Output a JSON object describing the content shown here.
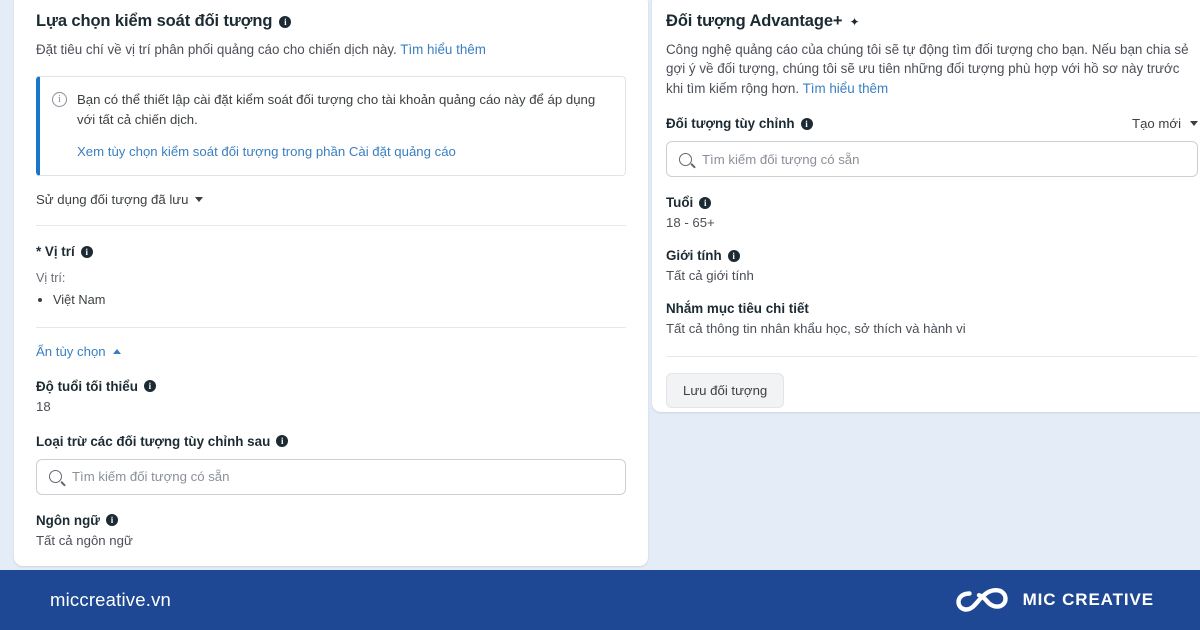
{
  "theme": {
    "page_background": "#e4ecf7",
    "card_background": "#ffffff",
    "link_color": "#3a7fc1",
    "banner_accent": "#1877c8",
    "footer_background": "#1f4894",
    "text_primary": "#1c2b33",
    "text_secondary": "#4b4f56"
  },
  "left_panel": {
    "title": "Lựa chọn kiểm soát đối tượng",
    "subtitle": "Đặt tiêu chí về vị trí phân phối quảng cáo cho chiến dịch này.",
    "subtitle_link": "Tìm hiểu thêm",
    "banner": {
      "icon": "info-circle-icon",
      "message": "Bạn có thể thiết lập cài đặt kiểm soát đối tượng cho tài khoản quảng cáo này để áp dụng với tất cả chiến dịch.",
      "link": "Xem tùy chọn kiểm soát đối tượng trong phần Cài đặt quảng cáo"
    },
    "saved_audience_dropdown": "Sử dụng đối tượng đã lưu",
    "location": {
      "label": "* Vị trí",
      "caption": "Vị trí:",
      "items": [
        "Việt Nam"
      ]
    },
    "toggle_options": "Ẩn tùy chọn",
    "min_age": {
      "label": "Độ tuổi tối thiểu",
      "value": "18"
    },
    "exclude_custom_audiences": {
      "label": "Loại trừ các đối tượng tùy chỉnh sau",
      "search_placeholder": "Tìm kiếm đối tượng có sẵn",
      "search_value": ""
    },
    "language": {
      "label": "Ngôn ngữ",
      "value": "Tất cả ngôn ngữ"
    }
  },
  "right_panel": {
    "title": "Đối tượng Advantage+",
    "title_icon": "sparkle-icon",
    "description": "Công nghệ quảng cáo của chúng tôi sẽ tự động tìm đối tượng cho bạn. Nếu bạn chia sẻ gợi ý về đối tượng, chúng tôi sẽ ưu tiên những đối tượng phù hợp với hồ sơ này trước khi tìm kiếm rộng hơn.",
    "description_link": "Tìm hiểu thêm",
    "custom_audience": {
      "label": "Đối tượng tùy chỉnh",
      "create_new": "Tạo mới",
      "search_placeholder": "Tìm kiếm đối tượng có sẵn",
      "search_value": ""
    },
    "age": {
      "label": "Tuổi",
      "value": "18 - 65+"
    },
    "gender": {
      "label": "Giới tính",
      "value": "Tất cả giới tính"
    },
    "detailed_targeting": {
      "label": "Nhắm mục tiêu chi tiết",
      "value": "Tất cả thông tin nhân khẩu học, sở thích và hành vi"
    },
    "save_button": "Lưu đối tượng"
  },
  "footer": {
    "url": "miccreative.vn",
    "brand_name": "MIC CREATIVE",
    "logo_icon": "infinity-loop-logo-icon"
  }
}
